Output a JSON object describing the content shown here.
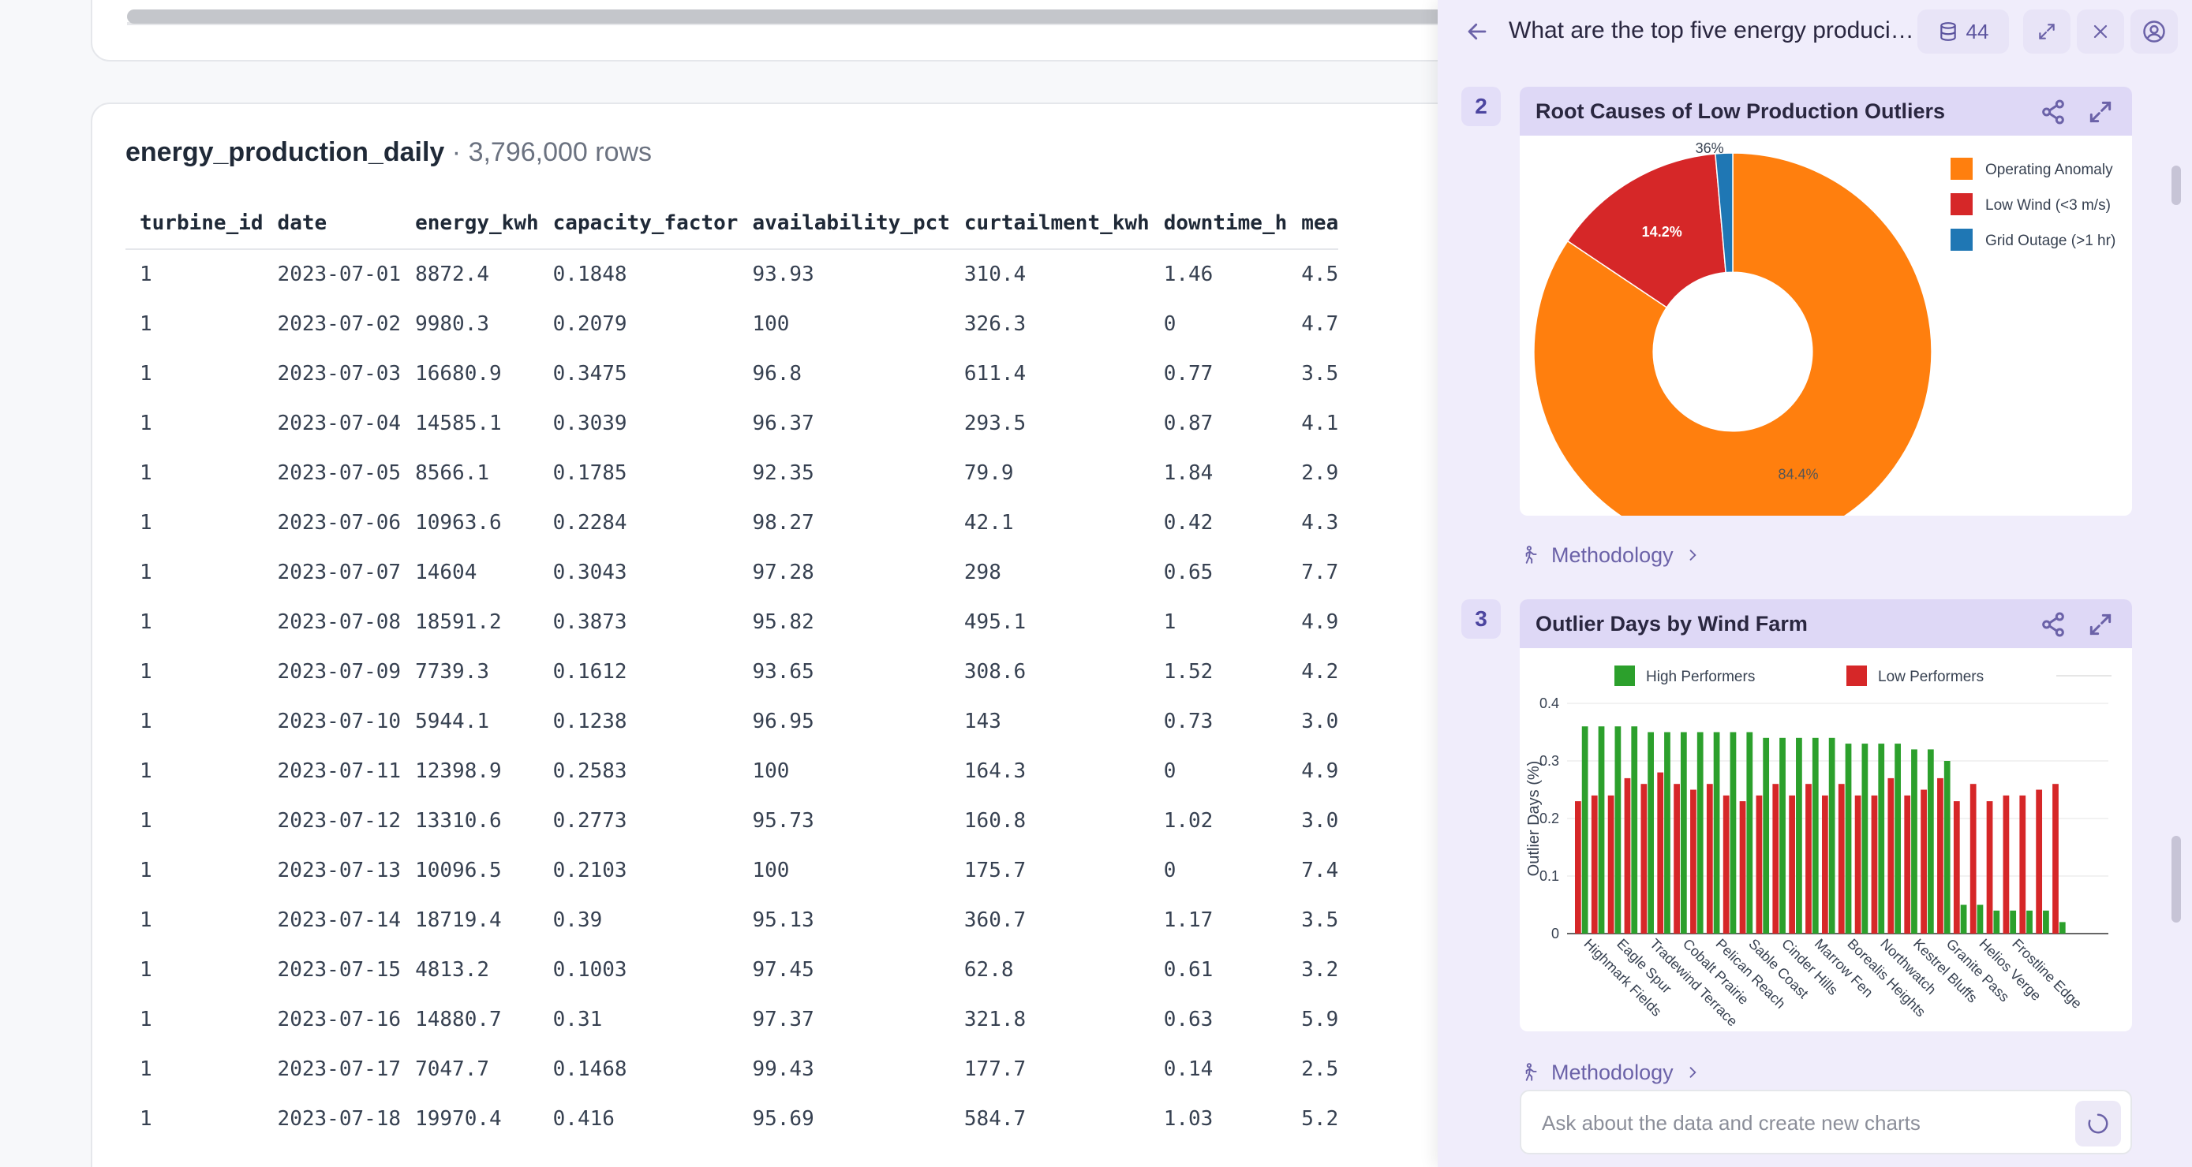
{
  "table": {
    "name": "energy_production_daily",
    "separator": "·",
    "row_count": "3,796,000 rows",
    "columns": [
      "turbine_id",
      "date",
      "energy_kwh",
      "capacity_factor",
      "availability_pct",
      "curtailment_kwh",
      "downtime_h",
      "mea"
    ],
    "rows": [
      [
        "1",
        "2023-07-01",
        "8872.4",
        "0.1848",
        "93.93",
        "310.4",
        "1.46",
        "4.5"
      ],
      [
        "1",
        "2023-07-02",
        "9980.3",
        "0.2079",
        "100",
        "326.3",
        "0",
        "4.7"
      ],
      [
        "1",
        "2023-07-03",
        "16680.9",
        "0.3475",
        "96.8",
        "611.4",
        "0.77",
        "3.5"
      ],
      [
        "1",
        "2023-07-04",
        "14585.1",
        "0.3039",
        "96.37",
        "293.5",
        "0.87",
        "4.1"
      ],
      [
        "1",
        "2023-07-05",
        "8566.1",
        "0.1785",
        "92.35",
        "79.9",
        "1.84",
        "2.9"
      ],
      [
        "1",
        "2023-07-06",
        "10963.6",
        "0.2284",
        "98.27",
        "42.1",
        "0.42",
        "4.3"
      ],
      [
        "1",
        "2023-07-07",
        "14604",
        "0.3043",
        "97.28",
        "298",
        "0.65",
        "7.7"
      ],
      [
        "1",
        "2023-07-08",
        "18591.2",
        "0.3873",
        "95.82",
        "495.1",
        "1",
        "4.9"
      ],
      [
        "1",
        "2023-07-09",
        "7739.3",
        "0.1612",
        "93.65",
        "308.6",
        "1.52",
        "4.2"
      ],
      [
        "1",
        "2023-07-10",
        "5944.1",
        "0.1238",
        "96.95",
        "143",
        "0.73",
        "3.0"
      ],
      [
        "1",
        "2023-07-11",
        "12398.9",
        "0.2583",
        "100",
        "164.3",
        "0",
        "4.9"
      ],
      [
        "1",
        "2023-07-12",
        "13310.6",
        "0.2773",
        "95.73",
        "160.8",
        "1.02",
        "3.0"
      ],
      [
        "1",
        "2023-07-13",
        "10096.5",
        "0.2103",
        "100",
        "175.7",
        "0",
        "7.4"
      ],
      [
        "1",
        "2023-07-14",
        "18719.4",
        "0.39",
        "95.13",
        "360.7",
        "1.17",
        "3.5"
      ],
      [
        "1",
        "2023-07-15",
        "4813.2",
        "0.1003",
        "97.45",
        "62.8",
        "0.61",
        "3.2"
      ],
      [
        "1",
        "2023-07-16",
        "14880.7",
        "0.31",
        "97.37",
        "321.8",
        "0.63",
        "5.9"
      ],
      [
        "1",
        "2023-07-17",
        "7047.7",
        "0.1468",
        "99.43",
        "177.7",
        "0.14",
        "2.5"
      ],
      [
        "1",
        "2023-07-18",
        "19970.4",
        "0.416",
        "95.69",
        "584.7",
        "1.03",
        "5.2"
      ]
    ]
  },
  "panel": {
    "title": "What are the top five energy producing...",
    "source_count": "44",
    "methodology_label": "Methodology",
    "input_placeholder": "Ask about the data and create new charts",
    "charts": [
      {
        "number": "2",
        "title": "Root Causes of Low Production Outliers"
      },
      {
        "number": "3",
        "title": "Outlier Days by Wind Farm"
      }
    ]
  },
  "chart_data": [
    {
      "type": "pie",
      "title": "Root Causes of Low Production Outliers",
      "labels": [
        "Operating Anomaly",
        "Low Wind (<3 m/s)",
        "Grid Outage (>1 hr)"
      ],
      "values": [
        84.4,
        14.2,
        1.4
      ],
      "data_labels": [
        "84.4%",
        "14.2%",
        "36%"
      ],
      "colors": [
        "#ff7f0e",
        "#d62728",
        "#1f77b4"
      ],
      "hole": 0.4,
      "legend": "right"
    },
    {
      "type": "bar",
      "title": "Outlier Days by Wind Farm",
      "ylabel": "Outlier Days (%)",
      "xlabel": "",
      "ylim": [
        0,
        0.4
      ],
      "yticks": [
        "0",
        "0.1",
        "0.2",
        "0.3",
        "0.4"
      ],
      "legend": "top",
      "categories": [
        "Highmark Fields",
        "Eagle Spur",
        "Tradewind Terrace",
        "Cobalt Prairie",
        "Pelican Reach",
        "Sable Coast",
        "Cinder Hills",
        "Marrow Fen",
        "Borealis Heights",
        "Northwatch",
        "Kestrel Bluffs",
        "Granite Pass",
        "Helios Verge",
        "Frostline Edge"
      ],
      "series": [
        {
          "name": "High Performers",
          "color": "#2ca02c",
          "values": [
            0.36,
            0.36,
            0.36,
            0.36,
            0.35,
            0.35,
            0.35,
            0.35,
            0.35,
            0.35,
            0.35,
            0.34,
            0.34,
            0.34,
            0.34,
            0.34,
            0.33,
            0.33,
            0.33,
            0.33,
            0.32,
            0.32,
            0.3,
            0.05,
            0.05,
            0.04,
            0.04,
            0.04,
            0.04,
            0.02
          ]
        },
        {
          "name": "Low Performers",
          "color": "#d62728",
          "values": [
            0.23,
            0.24,
            0.24,
            0.27,
            0.26,
            0.28,
            0.26,
            0.25,
            0.26,
            0.24,
            0.23,
            0.24,
            0.26,
            0.24,
            0.26,
            0.24,
            0.26,
            0.24,
            0.24,
            0.27,
            0.24,
            0.25,
            0.27,
            0.23,
            0.26,
            0.23,
            0.24,
            0.24,
            0.25,
            0.26
          ]
        }
      ]
    }
  ]
}
